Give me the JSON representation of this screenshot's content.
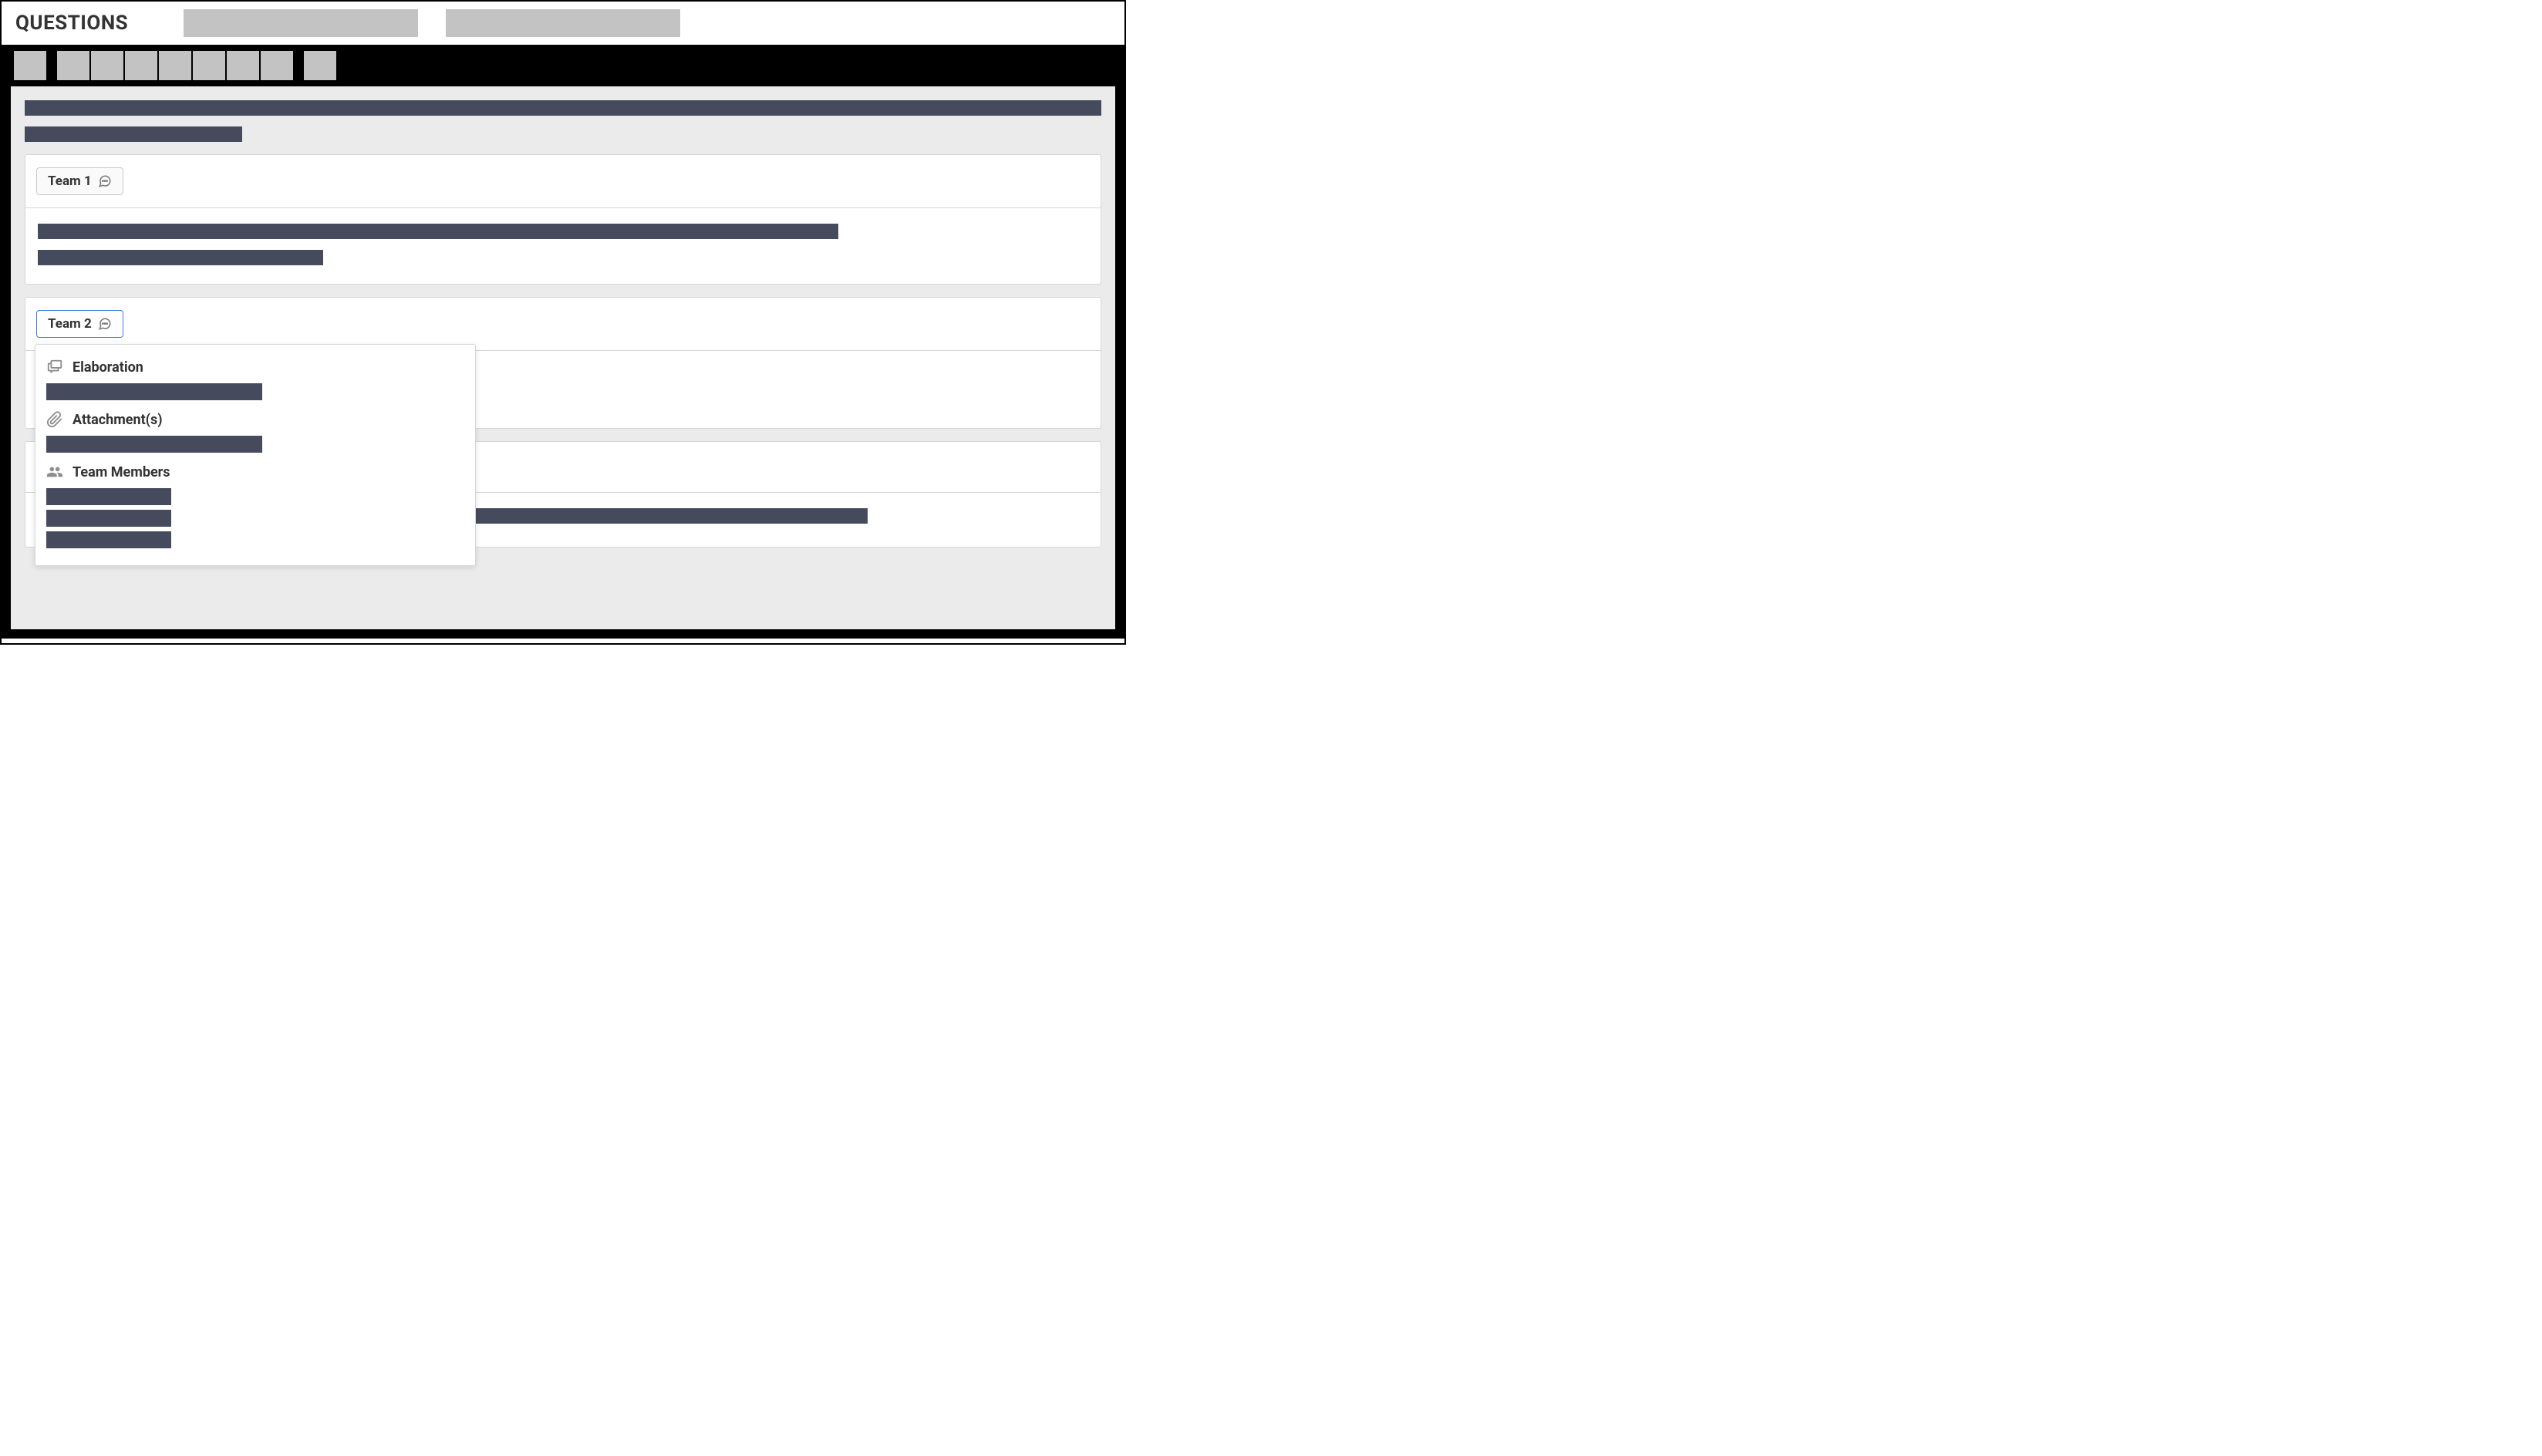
{
  "header": {
    "title": "QUESTIONS",
    "tabs": [
      "",
      ""
    ]
  },
  "toolbar": {
    "group1": [
      ""
    ],
    "group2": [
      "",
      "",
      "",
      "",
      "",
      "",
      ""
    ],
    "group3": [
      ""
    ]
  },
  "question": {
    "line1": "",
    "line2": ""
  },
  "teams": [
    {
      "label": "Team 1",
      "active": false,
      "answers": [
        "",
        ""
      ]
    },
    {
      "label": "Team 2",
      "active": true,
      "popover": {
        "elaboration_label": "Elaboration",
        "elaboration_content": [
          ""
        ],
        "attachments_label": "Attachment(s)",
        "attachments_content": [
          ""
        ],
        "members_label": "Team Members",
        "members": [
          "",
          "",
          ""
        ]
      }
    },
    {
      "label": "",
      "active": false,
      "answers": [
        ""
      ]
    }
  ]
}
